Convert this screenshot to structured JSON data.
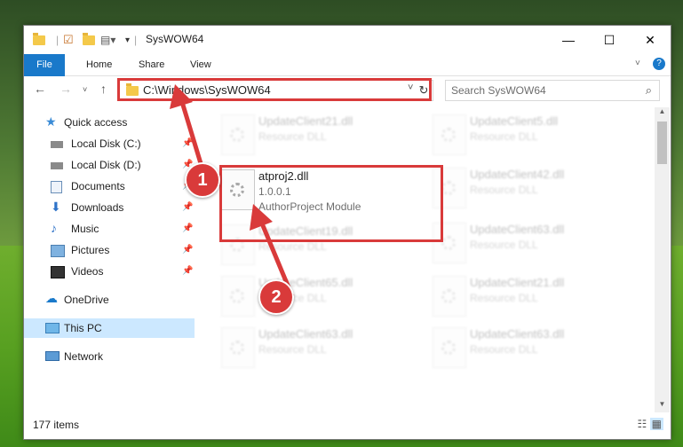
{
  "window": {
    "title": "SysWOW64"
  },
  "ribbon": {
    "tabs": [
      "File",
      "Home",
      "Share",
      "View"
    ]
  },
  "address": {
    "path": "C:\\Windows\\SysWOW64"
  },
  "search": {
    "placeholder": "Search SysWOW64"
  },
  "navpane": {
    "items": [
      {
        "label": "Quick access",
        "icon": "star-icon",
        "pinned": false
      },
      {
        "label": "Local Disk (C:)",
        "icon": "drive-icon",
        "pinned": true
      },
      {
        "label": "Local Disk (D:)",
        "icon": "drive-icon",
        "pinned": true
      },
      {
        "label": "Documents",
        "icon": "documents-icon",
        "pinned": true
      },
      {
        "label": "Downloads",
        "icon": "download-icon",
        "pinned": true
      },
      {
        "label": "Music",
        "icon": "music-icon",
        "pinned": true
      },
      {
        "label": "Pictures",
        "icon": "pictures-icon",
        "pinned": true
      },
      {
        "label": "Videos",
        "icon": "videos-icon",
        "pinned": true
      },
      {
        "label": "OneDrive",
        "icon": "cloud-icon",
        "pinned": false
      },
      {
        "label": "This PC",
        "icon": "computer-icon",
        "pinned": false
      },
      {
        "label": "Network",
        "icon": "network-icon",
        "pinned": false
      }
    ]
  },
  "files": {
    "left": [
      {
        "name": "UpdateClient21.dll",
        "desc": "Resource DLL"
      },
      {
        "name": "atproj2.dll",
        "desc": "1.0.0.1",
        "desc2": "AuthorProject Module"
      },
      {
        "name": "UpdateClient19.dll",
        "desc": "Resource DLL"
      },
      {
        "name": "UpdateClient65.dll",
        "desc": "Resource DLL"
      },
      {
        "name": "UpdateClient63.dll",
        "desc": "Resource DLL"
      }
    ],
    "right": [
      {
        "name": "UpdateClient5.dll",
        "desc": "Resource DLL"
      },
      {
        "name": "UpdateClient42.dll",
        "desc": "Resource DLL"
      },
      {
        "name": "UpdateClient63.dll",
        "desc": "Resource DLL"
      },
      {
        "name": "UpdateClient21.dll",
        "desc": "Resource DLL"
      },
      {
        "name": "UpdateClient63.dll",
        "desc": "Resource DLL"
      }
    ]
  },
  "status": {
    "count": "177 items"
  },
  "callouts": [
    "1",
    "2"
  ],
  "colors": {
    "accent": "#1979ca",
    "highlight": "#d93a3a",
    "selected": "#cce8ff"
  }
}
